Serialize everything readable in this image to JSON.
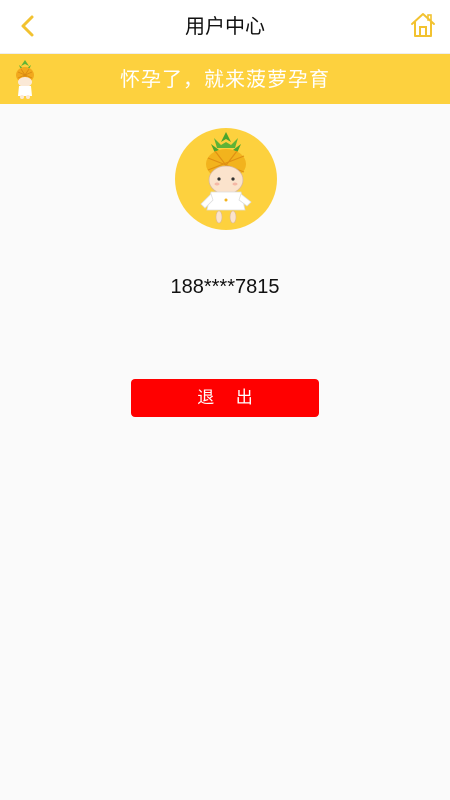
{
  "header": {
    "title": "用户中心",
    "back_icon": "chevron-left-icon",
    "home_icon": "home-icon",
    "accent_color": "#f2c230"
  },
  "banner": {
    "text": "怀孕了，就来菠萝孕育",
    "background": "#fdd13e",
    "mascot_icon": "pineapple-mascot-icon"
  },
  "profile": {
    "avatar_icon": "pineapple-mascot-avatar",
    "phone": "188****7815"
  },
  "actions": {
    "logout_label": "退 出",
    "logout_color": "#ff0000"
  }
}
